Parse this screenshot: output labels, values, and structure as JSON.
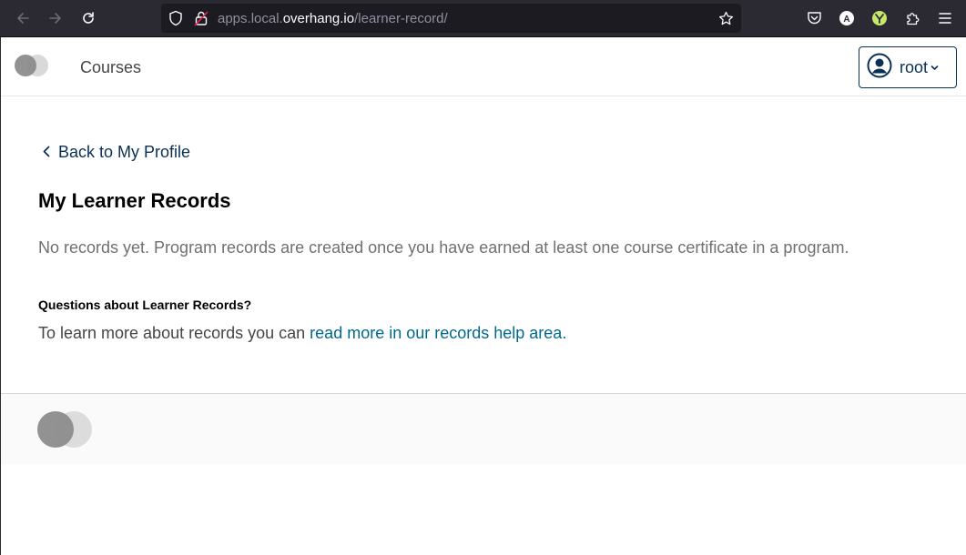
{
  "browser": {
    "url_prefix": "apps.local.",
    "url_host": "overhang.io",
    "url_path": "/learner-record/"
  },
  "header": {
    "nav_courses": "Courses",
    "user_label": "root"
  },
  "main": {
    "back_link": "Back to My Profile",
    "title": "My Learner Records",
    "empty_message": "No records yet. Program records are created once you have earned at least one course certificate in a program.",
    "questions_heading": "Questions about Learner Records?",
    "help_text_prefix": "To learn more about records you can ",
    "help_link": "read more in our records help area."
  },
  "colors": {
    "brand_dark": "#0a3055",
    "link": "#00688d",
    "chrome_bg": "#2b2a33"
  }
}
